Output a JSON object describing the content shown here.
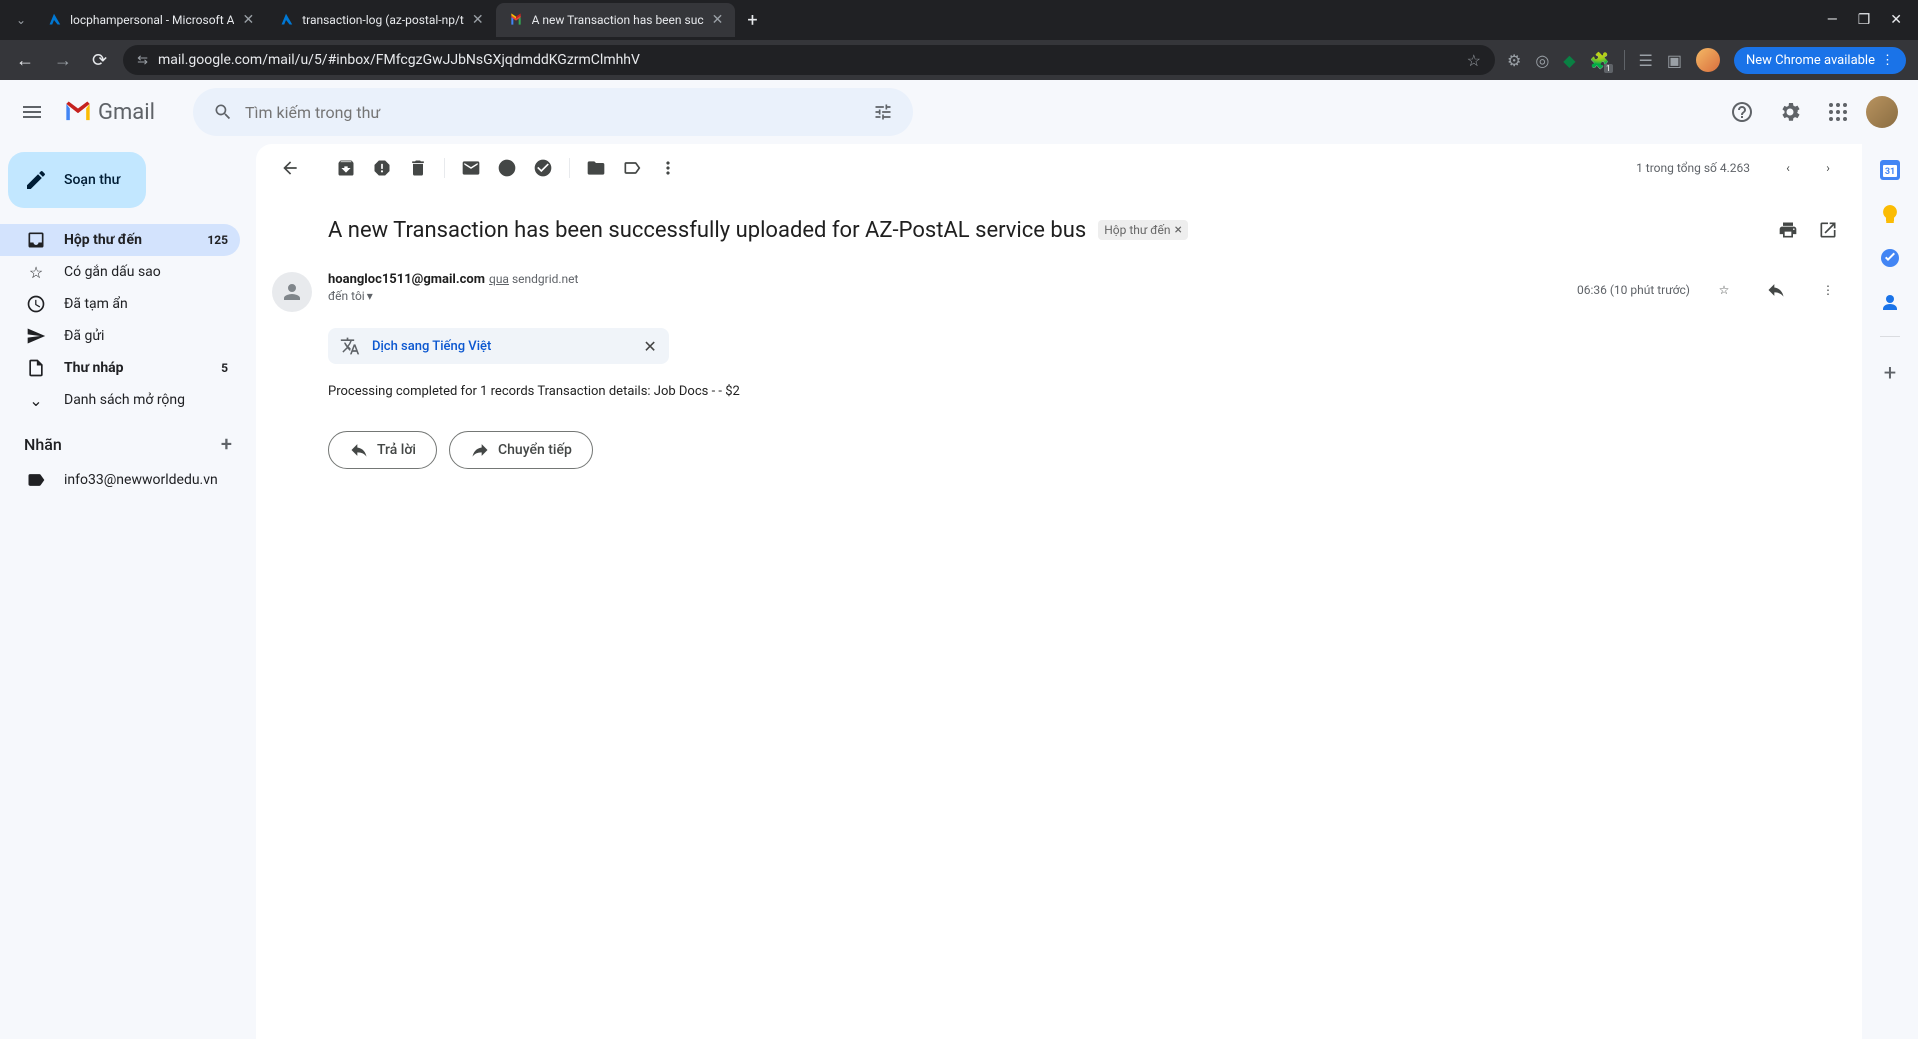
{
  "browser": {
    "tabs": [
      {
        "title": "locphampersonal - Microsoft A",
        "favicon": "azure"
      },
      {
        "title": "transaction-log (az-postal-np/t",
        "favicon": "azure"
      },
      {
        "title": "A new Transaction has been suc",
        "favicon": "gmail",
        "active": true
      }
    ],
    "url": "mail.google.com/mail/u/5/#inbox/FMfcgzGwJJbNsGXjqdmddKGzrmClmhhV",
    "update_label": "New Chrome available",
    "ext_badge": "1"
  },
  "gmail": {
    "logo_text": "Gmail",
    "search_placeholder": "Tìm kiếm trong thư",
    "compose_label": "Soạn thư",
    "nav": [
      {
        "icon": "inbox",
        "label": "Hộp thư đến",
        "count": "125",
        "active": true
      },
      {
        "icon": "star",
        "label": "Có gắn dấu sao"
      },
      {
        "icon": "clock",
        "label": "Đã tạm ẩn"
      },
      {
        "icon": "send",
        "label": "Đã gửi"
      },
      {
        "icon": "draft",
        "label": "Thư nháp",
        "count": "5",
        "bold": true
      },
      {
        "icon": "expand",
        "label": "Danh sách mở rộng"
      }
    ],
    "labels_header": "Nhãn",
    "labels": [
      {
        "label": "info33@newworldedu.vn"
      }
    ],
    "pagination": "1 trong tổng số 4.263",
    "email": {
      "subject": "A new Transaction has been successfully uploaded for AZ-PostAL service bus",
      "category": "Hộp thư đến",
      "sender_email": "hoangloc1511@gmail.com",
      "sender_via_label": "qua",
      "sender_via_domain": "sendgrid.net",
      "recipient": "đến tôi",
      "time": "06:36 (10 phút trước)",
      "translate_label": "Dịch sang Tiếng Việt",
      "body": "Processing completed for 1 records Transaction details: Job Docs - - $2",
      "reply_label": "Trả lời",
      "forward_label": "Chuyển tiếp"
    }
  }
}
